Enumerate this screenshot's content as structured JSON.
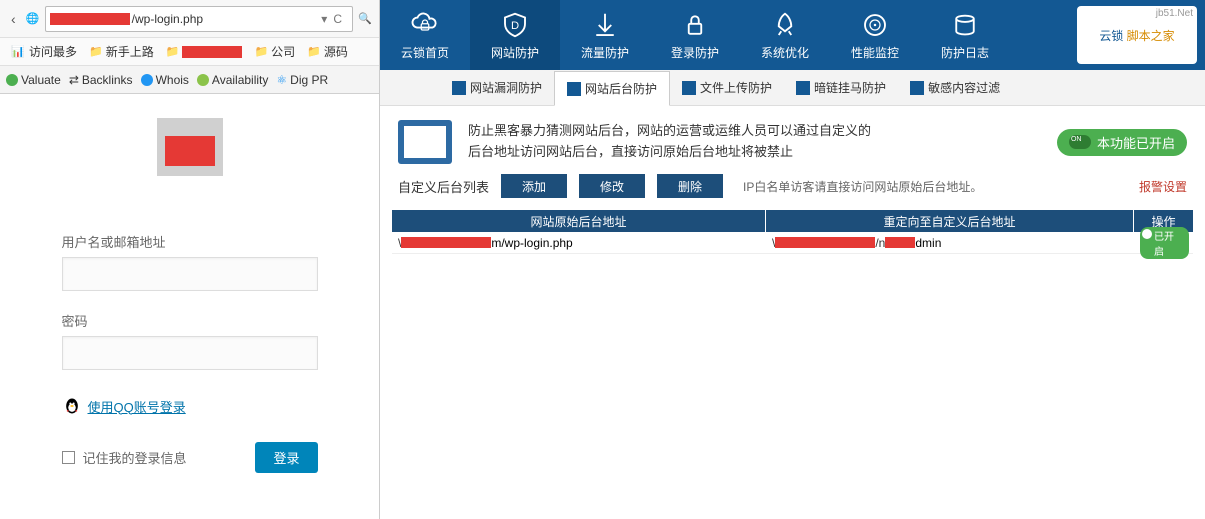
{
  "browser": {
    "url_suffix": "/wp-login.php",
    "dropdown_indicator": "▾",
    "ext_c": "C",
    "search_icon_label": "🔍"
  },
  "bookmarks": {
    "most_visited": "访问最多",
    "new_user": "新手上路",
    "company": "公司",
    "source": "源码"
  },
  "toolbar": {
    "valuate": "Valuate",
    "backlinks": "Backlinks",
    "whois": "Whois",
    "availability": "Availability",
    "digpr": "Dig PR"
  },
  "login": {
    "username_label": "用户名或邮箱地址",
    "password_label": "密码",
    "qq_login": "使用QQ账号登录",
    "remember": "记住我的登录信息",
    "submit": "登录"
  },
  "topnav": {
    "home": "云锁首页",
    "web_protect": "网站防护",
    "traffic": "流量防护",
    "login_protect": "登录防护",
    "sys_opt": "系统优化",
    "perf": "性能监控",
    "log": "防护日志",
    "brand_line1": "云锁",
    "brand_line2": "脚本之家",
    "brand_wm": "jb51.Net"
  },
  "subtabs": {
    "vuln": "网站漏洞防护",
    "admin": "网站后台防护",
    "upload": "文件上传防护",
    "darklink": "暗链挂马防护",
    "sensitive": "敏感内容过滤"
  },
  "desc": {
    "line1": "防止黑客暴力猜测网站后台，网站的运营或运维人员可以通过自定义的",
    "line2": "后台地址访问网站后台，直接访问原始后台地址将被禁止"
  },
  "status_badge": "本功能已开启",
  "actions": {
    "list_label": "自定义后台列表",
    "add": "添加",
    "edit": "修改",
    "delete": "删除",
    "hint": "IP白名单访客请直接访问网站原始后台地址。",
    "alarm": "报警设置"
  },
  "table": {
    "col1": "网站原始后台地址",
    "col2": "重定向至自定义后台地址",
    "col3": "操作",
    "row1": {
      "orig_suffix": "m/wp-login.php",
      "redirect_suffix": "dmin",
      "status": "已开启"
    }
  }
}
